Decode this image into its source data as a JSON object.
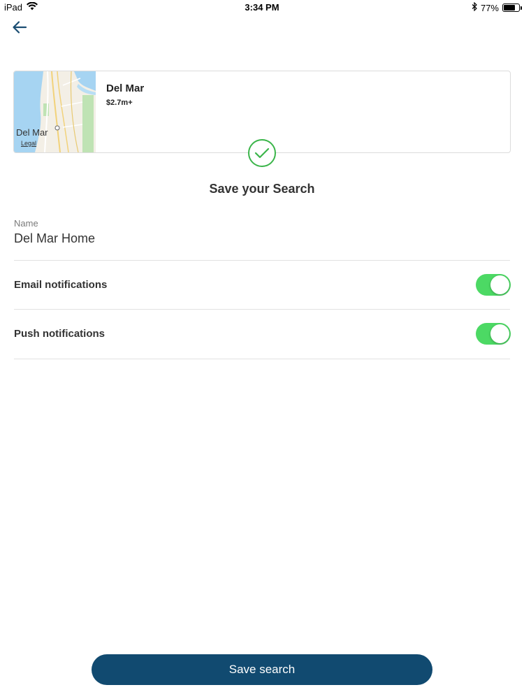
{
  "status_bar": {
    "device": "iPad",
    "time": "3:34 PM",
    "battery_percent": "77%",
    "battery_level": 0.77
  },
  "icons": {
    "back": "arrow-left-icon",
    "wifi": "wifi-icon",
    "bluetooth": "bluetooth-icon",
    "battery": "battery-icon",
    "check": "checkmark-icon"
  },
  "card": {
    "map_label": "Del Mar",
    "map_legal": "Legal",
    "title": "Del Mar",
    "price": "$2.7m+"
  },
  "heading": "Save your Search",
  "name_field": {
    "label": "Name",
    "value": "Del Mar Home"
  },
  "email_notifications": {
    "label": "Email notifications",
    "enabled": true
  },
  "push_notifications": {
    "label": "Push notifications",
    "enabled": true
  },
  "save_button": {
    "label": "Save search"
  },
  "colors": {
    "accent": "#114a70",
    "toggle_on": "#4cd964",
    "check": "#3bb54a",
    "back_arrow": "#1a4d72"
  }
}
